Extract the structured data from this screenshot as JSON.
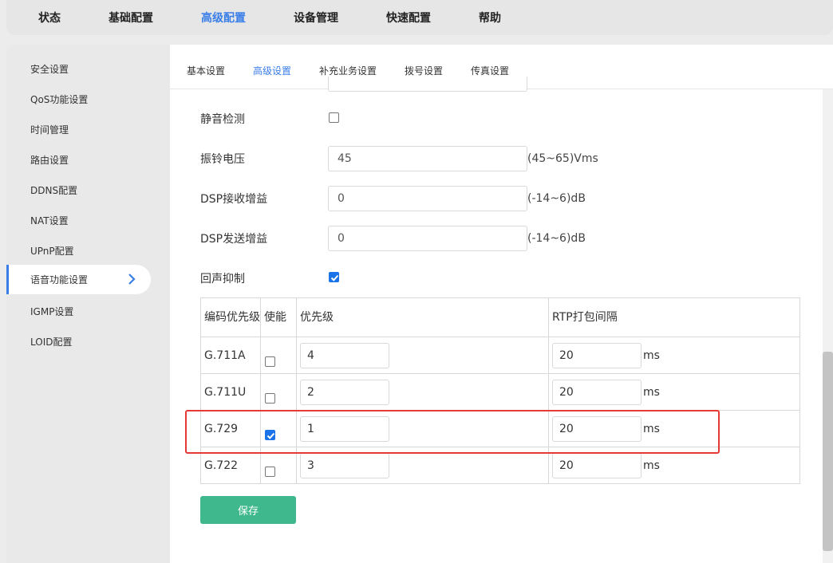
{
  "top_nav": {
    "items": [
      "状态",
      "基础配置",
      "高级配置",
      "设备管理",
      "快速配置",
      "帮助"
    ],
    "active": "高级配置"
  },
  "sidebar": {
    "items": [
      "安全设置",
      "QoS功能设置",
      "时间管理",
      "路由设置",
      "DDNS配置",
      "NAT设置",
      "UPnP配置",
      "语音功能设置",
      "IGMP设置",
      "LOID配置"
    ],
    "active": "语音功能设置"
  },
  "sub_tabs": {
    "items": [
      "基本设置",
      "高级设置",
      "补充业务设置",
      "拨号设置",
      "传真设置"
    ],
    "active": "高级设置"
  },
  "form": {
    "silence_detect": {
      "label": "静音检测",
      "checked": false
    },
    "ring_voltage": {
      "label": "振铃电压",
      "value": "45",
      "hint": "(45~65)Vms"
    },
    "dsp_rx_gain": {
      "label": "DSP接收增益",
      "value": "0",
      "hint": "(-14~6)dB"
    },
    "dsp_tx_gain": {
      "label": "DSP发送增益",
      "value": "0",
      "hint": "(-14~6)dB"
    },
    "echo_cancel": {
      "label": "回声抑制",
      "checked": true
    }
  },
  "codec_table": {
    "headers": [
      "编码优先级",
      "使能",
      "优先级",
      "RTP打包间隔"
    ],
    "unit": "ms",
    "rows": [
      {
        "codec": "G.711A",
        "enabled": false,
        "priority": "4",
        "rtp": "20"
      },
      {
        "codec": "G.711U",
        "enabled": false,
        "priority": "2",
        "rtp": "20"
      },
      {
        "codec": "G.729",
        "enabled": true,
        "priority": "1",
        "rtp": "20"
      },
      {
        "codec": "G.722",
        "enabled": false,
        "priority": "3",
        "rtp": "20"
      }
    ]
  },
  "buttons": {
    "save": "保存"
  },
  "colors": {
    "accent": "#3a7ee8",
    "save": "#3fb88e",
    "highlight": "#e53935"
  }
}
